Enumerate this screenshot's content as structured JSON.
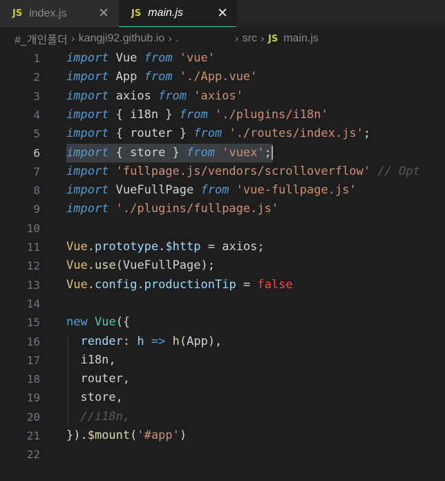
{
  "tabs": [
    {
      "badge": "JS",
      "name": "index.js",
      "close": "✕",
      "active": false
    },
    {
      "badge": "JS",
      "name": "main.js",
      "close": "✕",
      "active": true
    }
  ],
  "breadcrumb": {
    "items": [
      "#_개인폴더",
      "kangji92.github.io",
      ".",
      "src"
    ],
    "file_badge": "JS",
    "file": "main.js"
  },
  "editor": {
    "current_line": 6,
    "lines": [
      {
        "n": "1",
        "tokens": [
          [
            "kw",
            "import"
          ],
          [
            "ident",
            " Vue "
          ],
          [
            "kw",
            "from"
          ],
          [
            "ident",
            " "
          ],
          [
            "str",
            "'vue'"
          ]
        ]
      },
      {
        "n": "2",
        "tokens": [
          [
            "kw",
            "import"
          ],
          [
            "ident",
            " App "
          ],
          [
            "kw",
            "from"
          ],
          [
            "ident",
            " "
          ],
          [
            "str",
            "'./App.vue'"
          ]
        ]
      },
      {
        "n": "3",
        "tokens": [
          [
            "kw",
            "import"
          ],
          [
            "ident",
            " axios "
          ],
          [
            "kw",
            "from"
          ],
          [
            "ident",
            " "
          ],
          [
            "str",
            "'axios'"
          ]
        ]
      },
      {
        "n": "4",
        "tokens": [
          [
            "kw",
            "import"
          ],
          [
            "ident",
            " { i18n } "
          ],
          [
            "kw",
            "from"
          ],
          [
            "ident",
            " "
          ],
          [
            "str",
            "'./plugins/i18n'"
          ]
        ]
      },
      {
        "n": "5",
        "tokens": [
          [
            "kw",
            "import"
          ],
          [
            "ident",
            " { router } "
          ],
          [
            "kw",
            "from"
          ],
          [
            "ident",
            " "
          ],
          [
            "str",
            "'./routes/index.js'"
          ],
          [
            "ident",
            ";"
          ]
        ]
      },
      {
        "n": "6",
        "tokens": [
          [
            "kw",
            "import"
          ],
          [
            "ident",
            " { store } "
          ],
          [
            "kw",
            "from"
          ],
          [
            "ident",
            " "
          ],
          [
            "str",
            "'vuex'"
          ],
          [
            "ident",
            ";"
          ]
        ]
      },
      {
        "n": "7",
        "tokens": [
          [
            "kw",
            "import"
          ],
          [
            "ident",
            " "
          ],
          [
            "str",
            "'fullpage.js/vendors/scrolloverflow'"
          ],
          [
            "ident",
            " "
          ],
          [
            "cmt2",
            "// Opt"
          ]
        ]
      },
      {
        "n": "8",
        "tokens": [
          [
            "kw",
            "import"
          ],
          [
            "ident",
            " VueFullPage "
          ],
          [
            "kw",
            "from"
          ],
          [
            "ident",
            " "
          ],
          [
            "str",
            "'vue-fullpage.js'"
          ]
        ]
      },
      {
        "n": "9",
        "tokens": [
          [
            "kw",
            "import"
          ],
          [
            "ident",
            " "
          ],
          [
            "str",
            "'./plugins/fullpage.js'"
          ]
        ]
      },
      {
        "n": "10",
        "tokens": []
      },
      {
        "n": "11",
        "tokens": [
          [
            "vue-id",
            "Vue"
          ],
          [
            "ident",
            "."
          ],
          [
            "prop",
            "prototype"
          ],
          [
            "ident",
            "."
          ],
          [
            "prop",
            "$http"
          ],
          [
            "ident",
            " = axios;"
          ]
        ]
      },
      {
        "n": "12",
        "tokens": [
          [
            "vue-id",
            "Vue"
          ],
          [
            "ident",
            "."
          ],
          [
            "fn",
            "use"
          ],
          [
            "ident",
            "(VueFullPage);"
          ]
        ]
      },
      {
        "n": "13",
        "tokens": [
          [
            "vue-id",
            "Vue"
          ],
          [
            "ident",
            "."
          ],
          [
            "prop",
            "config"
          ],
          [
            "ident",
            "."
          ],
          [
            "prop",
            "productionTip"
          ],
          [
            "ident",
            " = "
          ],
          [
            "bool",
            "false"
          ]
        ]
      },
      {
        "n": "14",
        "tokens": []
      },
      {
        "n": "15",
        "tokens": [
          [
            "kwn",
            "new"
          ],
          [
            "ident",
            " "
          ],
          [
            "cls",
            "Vue"
          ],
          [
            "ident",
            "({"
          ]
        ]
      },
      {
        "n": "16",
        "tokens": [
          [
            "ident",
            "  "
          ],
          [
            "prop",
            "render"
          ],
          [
            "ident",
            ": "
          ],
          [
            "prop",
            "h"
          ],
          [
            "ident",
            " "
          ],
          [
            "kwn",
            "=>"
          ],
          [
            "ident",
            " "
          ],
          [
            "fn",
            "h"
          ],
          [
            "ident",
            "(App),"
          ]
        ]
      },
      {
        "n": "17",
        "tokens": [
          [
            "ident",
            "  i18n,"
          ]
        ]
      },
      {
        "n": "18",
        "tokens": [
          [
            "ident",
            "  router,"
          ]
        ]
      },
      {
        "n": "19",
        "tokens": [
          [
            "ident",
            "  store,"
          ]
        ]
      },
      {
        "n": "20",
        "tokens": [
          [
            "ident",
            "  "
          ],
          [
            "cmt2",
            "//i18n,"
          ]
        ]
      },
      {
        "n": "21",
        "tokens": [
          [
            "ident",
            "})."
          ],
          [
            "fn",
            "$mount"
          ],
          [
            "ident",
            "("
          ],
          [
            "str",
            "'#app'"
          ],
          [
            "ident",
            ")"
          ]
        ]
      },
      {
        "n": "22",
        "tokens": []
      }
    ]
  }
}
